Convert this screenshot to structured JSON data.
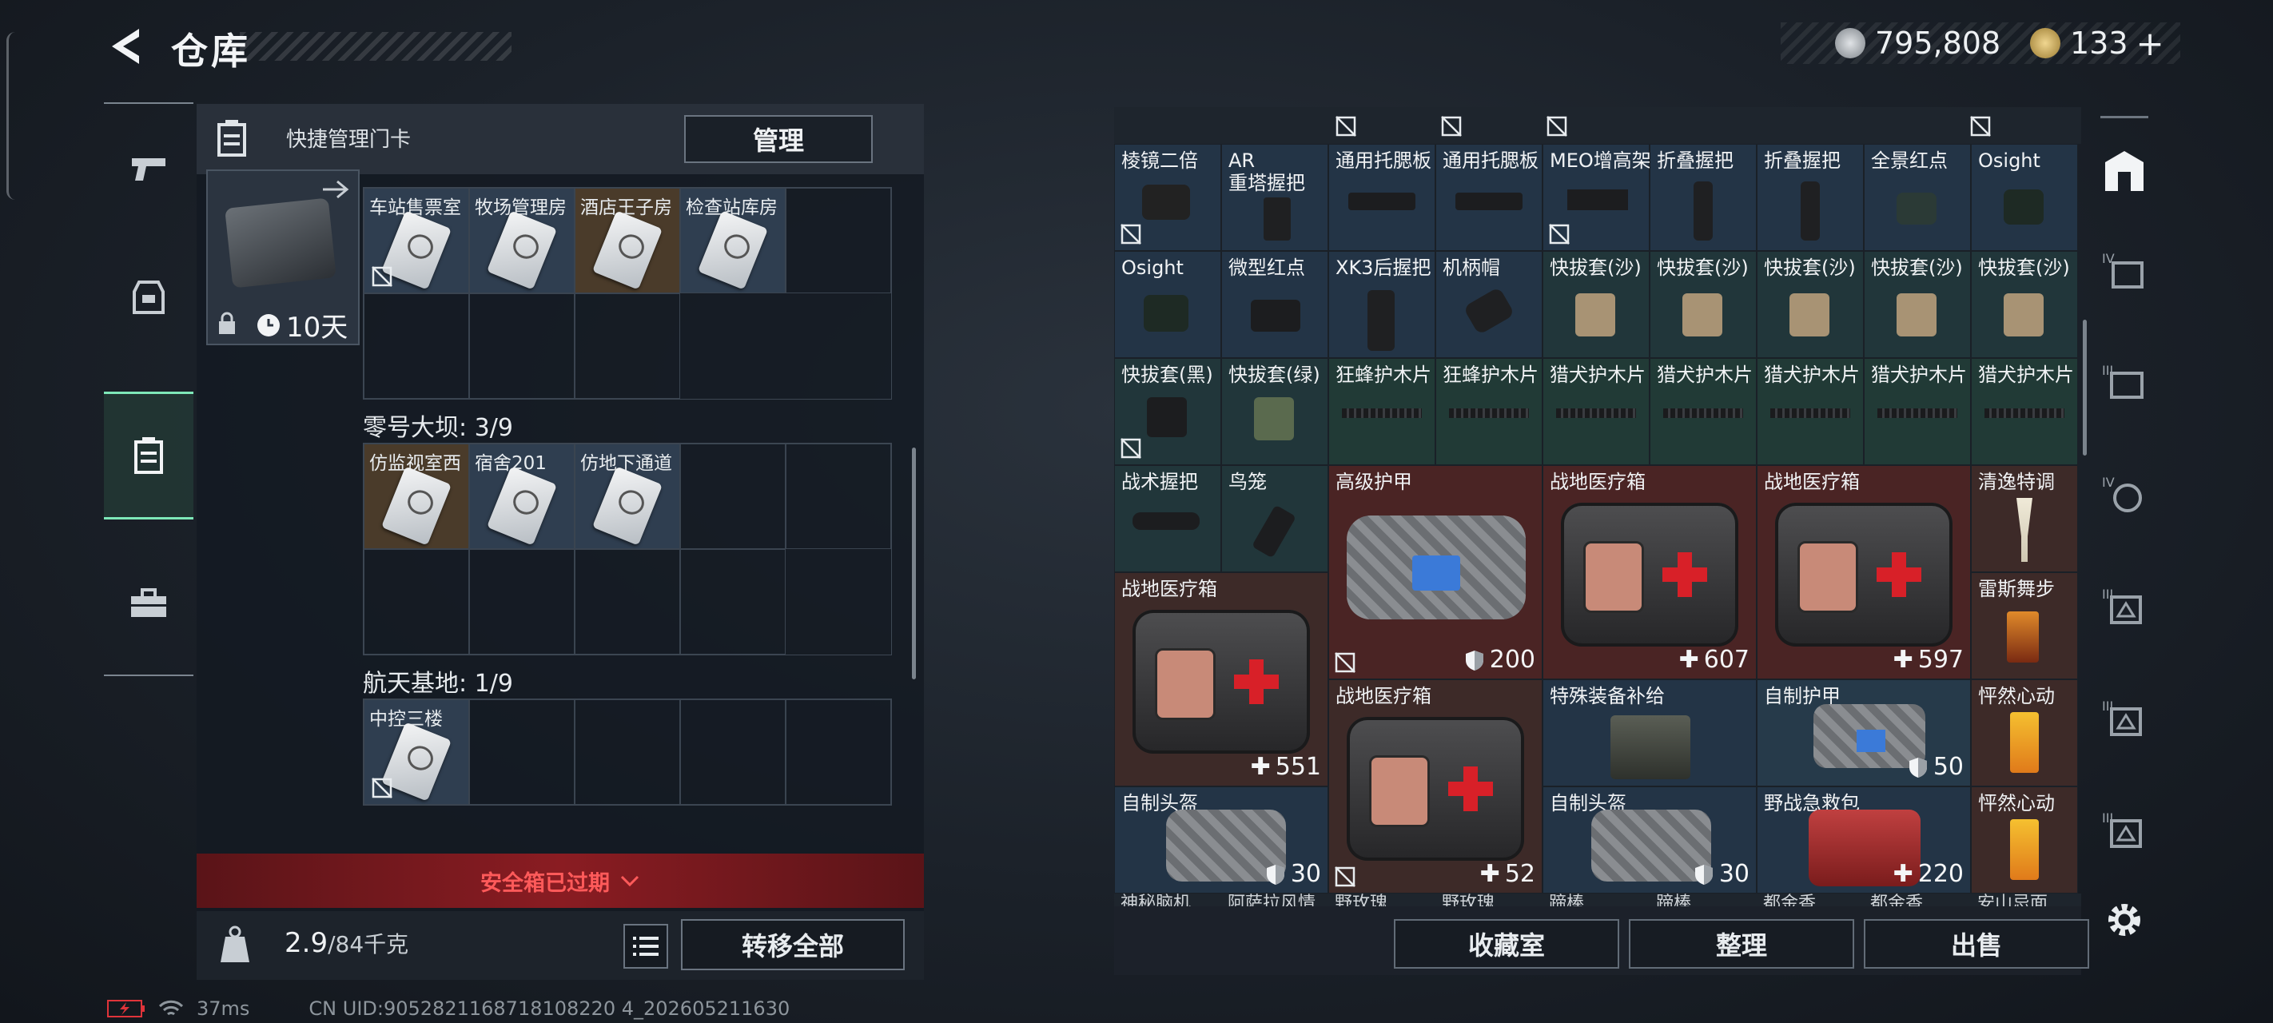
{
  "header": {
    "title": "仓库",
    "currency_primary": "795,808",
    "currency_secondary": "133",
    "add_symbol": "+"
  },
  "safe_box": {
    "header_label": "快捷管理门卡",
    "manage_label": "管理",
    "key_duration": "10天",
    "sections": [
      {
        "label": "",
        "items": [
          "车站售票室",
          "牧场管理房",
          "酒店王子房",
          "检查站库房"
        ]
      },
      {
        "label": "零号大坝: 3/9",
        "items": [
          "仿监视室西",
          "宿舍201",
          "仿地下通道"
        ]
      },
      {
        "label": "航天基地: 1/9",
        "items": [
          "中控三楼"
        ]
      }
    ],
    "expired_label": "安全箱已过期",
    "weight_value": "2.9",
    "weight_unit": "/84千克",
    "transfer_all_label": "转移全部"
  },
  "status": {
    "latency": "37ms",
    "uid": "CN UID:9052821168718108220 4_202605211630"
  },
  "warehouse": {
    "row1": [
      "棱镜二倍",
      "AR\n重塔握把",
      "通用托腮板",
      "通用托腮板",
      "MEO增高架",
      "折叠握把",
      "折叠握把",
      "全景红点",
      "Osight"
    ],
    "row2": [
      "Osight",
      "微型红点",
      "XK3后握把",
      "机柄帽",
      "快拔套(沙)",
      "快拔套(沙)",
      "快拔套(沙)",
      "快拔套(沙)",
      "快拔套(沙)"
    ],
    "row3": [
      "快拔套(黑)",
      "快拔套(绿)",
      "狂蜂护木片",
      "狂蜂护木片",
      "猎犬护木片",
      "猎犬护木片",
      "猎犬护木片",
      "猎犬护木片",
      "猎犬护木片"
    ],
    "row4": [
      "战术握把",
      "鸟笼"
    ],
    "armor_high": {
      "name": "高级护甲",
      "durability": "200"
    },
    "medkit_a": {
      "name": "战地医疗箱",
      "value": "607"
    },
    "medkit_b": {
      "name": "战地医疗箱",
      "value": "597"
    },
    "drink_1": "清逸特调",
    "drink_2": "雷斯舞步",
    "drink_3": "怦然心动",
    "drink_4": "怦然心动",
    "medkit_c": {
      "name": "战地医疗箱",
      "value": "551"
    },
    "medkit_d": {
      "name": "战地医疗箱",
      "value": "52"
    },
    "special_supply": "特殊装备补给",
    "self_armor": {
      "name": "自制护甲",
      "durability": "50"
    },
    "helmet_a": {
      "name": "自制头盔",
      "durability": "30"
    },
    "helmet_b": {
      "name": "自制头盔",
      "durability": "30"
    },
    "field_kit": {
      "name": "野战急救包",
      "value": "220"
    },
    "row_bottom_partial": [
      "神秘脑机",
      "阿萨拉风情",
      "野玫瑰",
      "野玫瑰",
      "蹄棒",
      "蹄棒",
      "都金香",
      "都金香",
      "安山忌面"
    ],
    "buttons": {
      "collection": "收藏室",
      "sort": "整理",
      "sell": "出售"
    }
  },
  "colors": {
    "accent_green": "#7ee8b8",
    "expired_red": "#ff5a5a",
    "cell_red": "#4a2424",
    "cell_blue": "#263a4a"
  }
}
